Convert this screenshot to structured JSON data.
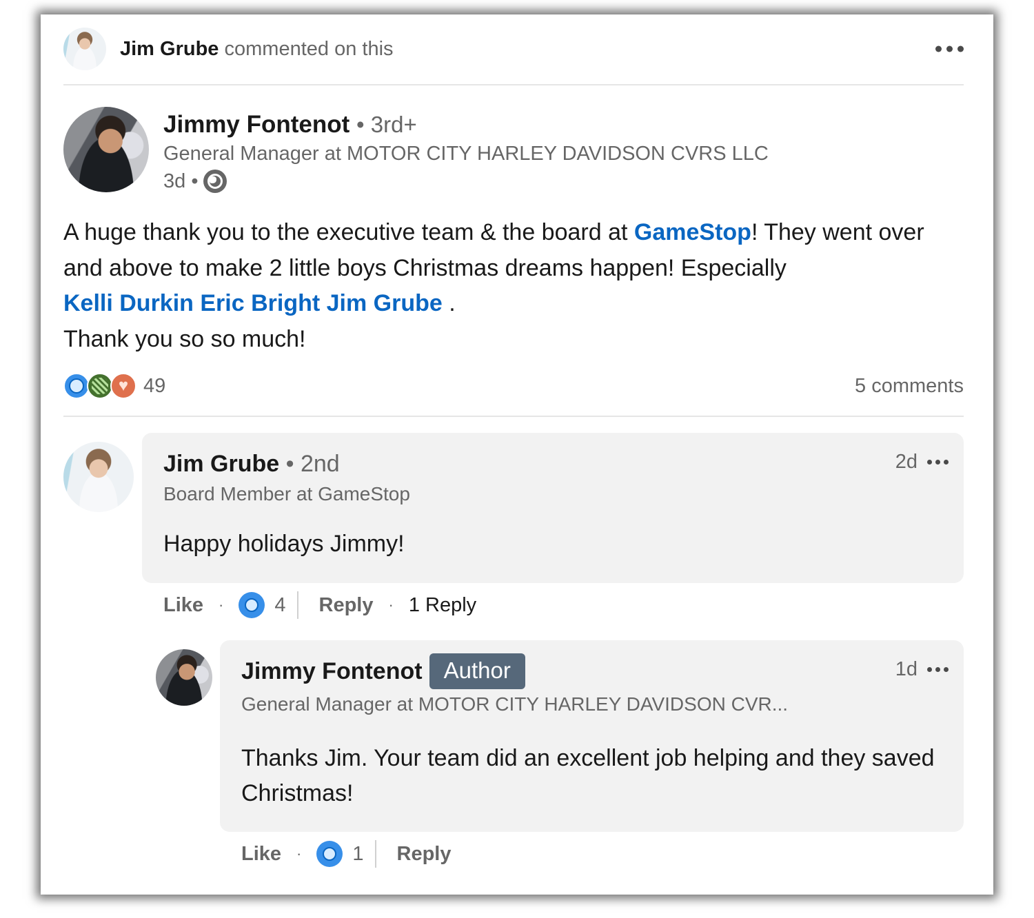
{
  "context": {
    "actor": "Jim Grube",
    "action": "commented on this"
  },
  "post": {
    "author": "Jimmy Fontenot",
    "degree": "• 3rd+",
    "headline": "General Manager at MOTOR CITY HARLEY DAVIDSON CVRS LLC",
    "time": "3d •",
    "visibility_icon": "globe-icon",
    "body": {
      "part1": "A huge thank you to the executive team & the board at ",
      "mention_company": "GameStop",
      "part2": "! They went over and above to make 2 little boys Christmas dreams happen! Especially",
      "mentions": "Kelli Durkin Eric Bright Jim Grube",
      "part3": " .",
      "line_last": "Thank you so so much!"
    },
    "reaction_count": "49",
    "comment_count": "5 comments"
  },
  "comments": [
    {
      "author": "Jim Grube",
      "degree": "• 2nd",
      "headline": "Board Member at GameStop",
      "time": "2d",
      "text": "Happy holidays Jimmy!",
      "like_label": "Like",
      "like_count": "4",
      "reply_label": "Reply",
      "replies_label": "1 Reply"
    },
    {
      "author": "Jimmy Fontenot",
      "badge": "Author",
      "headline": "General Manager at MOTOR CITY HARLEY DAVIDSON CVR...",
      "time": "1d",
      "text": "Thanks Jim. Your team did an excellent job helping and they saved Christmas!",
      "like_label": "Like",
      "like_count": "1",
      "reply_label": "Reply"
    }
  ],
  "colors": {
    "link": "#0a66c2",
    "muted": "#666666",
    "bubble": "#f2f2f2",
    "author_badge": "#56687a",
    "like": "#378fe9",
    "celebrate": "#44712e",
    "love": "#df704d"
  }
}
